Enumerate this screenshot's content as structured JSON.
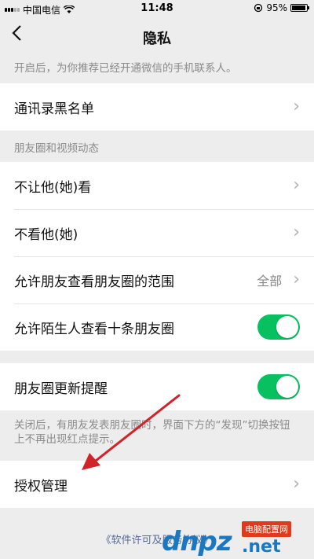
{
  "status_bar": {
    "carrier": "中国电信",
    "time": "11:48",
    "battery_percent": "95%",
    "battery_level": 0.95
  },
  "nav": {
    "title": "隐私",
    "back_icon": "chevron-left-icon"
  },
  "top_hint": "开启后，为你推荐已经开通微信的手机联系人。",
  "blacklist_row": {
    "label": "通讯录黑名单"
  },
  "moments_section": {
    "header": "朋友圈和视频动态",
    "rows": [
      {
        "label": "不让他(她)看"
      },
      {
        "label": "不看他(她)"
      },
      {
        "label": "允许朋友查看朋友圈的范围",
        "value": "全部"
      },
      {
        "label": "允许陌生人查看十条朋友圈",
        "toggle_on": true
      }
    ]
  },
  "update_reminder": {
    "label": "朋友圈更新提醒",
    "toggle_on": true,
    "hint": "关闭后，有朋友发表朋友圈时，界面下方的“发现”切换按钮上不再出现红点提示。"
  },
  "auth_row": {
    "label": "授权管理"
  },
  "footer": {
    "link": "《软件许可及服务协议》"
  },
  "watermark": {
    "brand": "dnpz",
    "tag": "电脑配置网",
    "suffix": ".net"
  },
  "colors": {
    "toggle_on": "#07c160",
    "background": "#ededed",
    "link": "#576b95",
    "annotation_arrow": "#d2232a"
  }
}
